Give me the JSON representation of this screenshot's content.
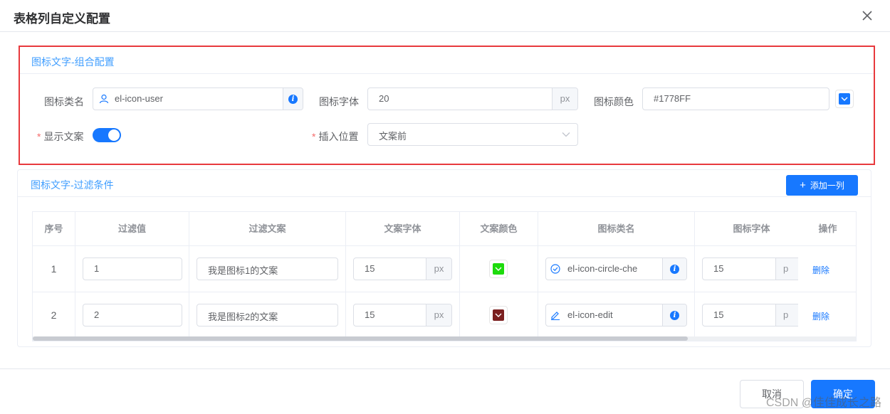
{
  "dialog": {
    "title": "表格列自定义配置"
  },
  "group_config": {
    "title": "图标文字-组合配置",
    "icon_class_label": "图标类名",
    "icon_class_value": "el-icon-user",
    "icon_size_label": "图标字体",
    "icon_size_value": "20",
    "icon_size_unit": "px",
    "icon_color_label": "图标颜色",
    "icon_color_value": "#1778FF",
    "show_text_label": "显示文案",
    "show_text_on": true,
    "insert_position_label": "插入位置",
    "insert_position_value": "文案前",
    "required_mark": "*"
  },
  "filter": {
    "title": "图标文字-过滤条件",
    "add_button_icon": "+",
    "add_button_label": "添加一列",
    "columns": [
      "序号",
      "过滤值",
      "过滤文案",
      "文案字体",
      "文案颜色",
      "图标类名",
      "图标字体",
      "操作"
    ],
    "rows": [
      {
        "index": "1",
        "value": "1",
        "text": "我是图标1的文案",
        "font_size": "15",
        "font_unit": "px",
        "text_color": "#1ddb0c",
        "icon_name": "circle-check-icon",
        "icon_class": "el-icon-circle-che",
        "icon_size": "15",
        "icon_unit": "p",
        "delete_label": "删除"
      },
      {
        "index": "2",
        "value": "2",
        "text": "我是图标2的文案",
        "font_size": "15",
        "font_unit": "px",
        "text_color": "#7b1f1f",
        "icon_name": "edit-icon",
        "icon_class": "el-icon-edit",
        "icon_size": "15",
        "icon_unit": "p",
        "delete_label": "删除"
      }
    ]
  },
  "footer": {
    "cancel_label": "取消",
    "ok_label": "确定"
  },
  "watermark": "CSDN @佳佳成长之路",
  "colors": {
    "primary": "#1778FF",
    "highlight_border": "#e8393d",
    "title_blue": "#409eff"
  }
}
